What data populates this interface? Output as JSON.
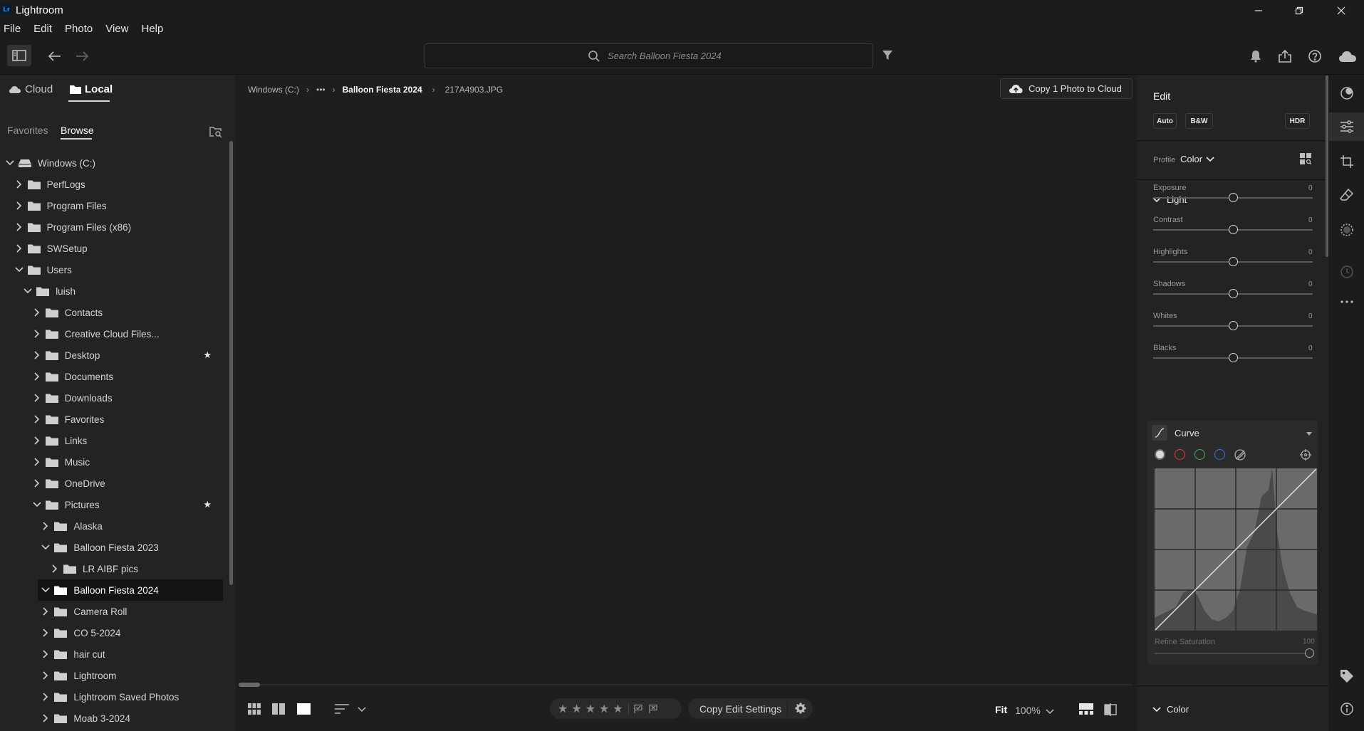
{
  "window": {
    "title": "Lightroom",
    "logo_text": "Lr",
    "controls": [
      "minimize-icon",
      "restore-icon",
      "close-icon"
    ]
  },
  "menu": [
    "File",
    "Edit",
    "Photo",
    "View",
    "Help"
  ],
  "toolbar": {
    "search_placeholder": "Search Balloon Fiesta 2024",
    "icons": [
      "panel-toggle-icon",
      "back-arrow-icon",
      "forward-arrow-icon",
      "filter-icon",
      "bell-icon",
      "share-icon",
      "help-icon",
      "cloud-icon"
    ]
  },
  "left": {
    "source_tabs": [
      "Cloud",
      "Local"
    ],
    "active_source": "Local",
    "sub_tabs": [
      "Favorites",
      "Browse"
    ],
    "active_sub_tab": "Browse",
    "tree": [
      {
        "label": "Windows (C:)",
        "depth": 0,
        "expanded": true,
        "kind": "drive"
      },
      {
        "label": "PerfLogs",
        "depth": 1,
        "expanded": false
      },
      {
        "label": "Program Files",
        "depth": 1,
        "expanded": false
      },
      {
        "label": "Program Files (x86)",
        "depth": 1,
        "expanded": false
      },
      {
        "label": "SWSetup",
        "depth": 1,
        "expanded": false
      },
      {
        "label": "Users",
        "depth": 1,
        "expanded": true
      },
      {
        "label": "luish",
        "depth": 2,
        "expanded": true
      },
      {
        "label": "Contacts",
        "depth": 3,
        "expanded": false
      },
      {
        "label": "Creative Cloud Files...",
        "depth": 3,
        "expanded": false
      },
      {
        "label": "Desktop",
        "depth": 3,
        "expanded": false,
        "starred": true
      },
      {
        "label": "Documents",
        "depth": 3,
        "expanded": false
      },
      {
        "label": "Downloads",
        "depth": 3,
        "expanded": false
      },
      {
        "label": "Favorites",
        "depth": 3,
        "expanded": false
      },
      {
        "label": "Links",
        "depth": 3,
        "expanded": false
      },
      {
        "label": "Music",
        "depth": 3,
        "expanded": false
      },
      {
        "label": "OneDrive",
        "depth": 3,
        "expanded": false
      },
      {
        "label": "Pictures",
        "depth": 3,
        "expanded": true,
        "starred": true
      },
      {
        "label": "Alaska",
        "depth": 4,
        "expanded": false
      },
      {
        "label": "Balloon Fiesta 2023",
        "depth": 4,
        "expanded": true
      },
      {
        "label": "LR AIBF pics",
        "depth": 5,
        "expanded": false
      },
      {
        "label": "Balloon Fiesta 2024",
        "depth": 4,
        "expanded": true,
        "selected": true
      },
      {
        "label": "Camera Roll",
        "depth": 4,
        "expanded": false
      },
      {
        "label": "CO 5-2024",
        "depth": 4,
        "expanded": false
      },
      {
        "label": "hair cut",
        "depth": 4,
        "expanded": false
      },
      {
        "label": "Lightroom",
        "depth": 4,
        "expanded": false
      },
      {
        "label": "Lightroom Saved Photos",
        "depth": 4,
        "expanded": false
      },
      {
        "label": "Moab 3-2024",
        "depth": 4,
        "expanded": false
      }
    ],
    "star_glyph": "★"
  },
  "center": {
    "breadcrumb": [
      "Windows (C:)",
      "•••",
      "Balloon Fiesta 2024",
      "217A4903.JPG"
    ],
    "copy_cloud_label": "Copy 1 Photo to Cloud",
    "rating_stars": [
      "★",
      "★",
      "★",
      "★",
      "★"
    ],
    "copy_edit_label": "Copy Edit Settings",
    "zoom_fit": "Fit",
    "zoom_value": "100%"
  },
  "right": {
    "edit_title": "Edit",
    "presets": [
      "Auto",
      "B&W",
      "HDR"
    ],
    "profile_label": "Profile",
    "profile_value": "Color",
    "light_title": "Light",
    "sliders": [
      {
        "label": "Exposure",
        "value": "0"
      },
      {
        "label": "Contrast",
        "value": "0"
      },
      {
        "label": "Highlights",
        "value": "0"
      },
      {
        "label": "Shadows",
        "value": "0"
      },
      {
        "label": "Whites",
        "value": "0"
      },
      {
        "label": "Blacks",
        "value": "0"
      }
    ],
    "curve_title": "Curve",
    "refine_label": "Refine Saturation",
    "refine_value": "100",
    "color_title": "Color"
  },
  "colors": {
    "accent_red": "#e23a3a",
    "accent_green": "#3ab24a",
    "accent_blue": "#3a6ee2"
  }
}
